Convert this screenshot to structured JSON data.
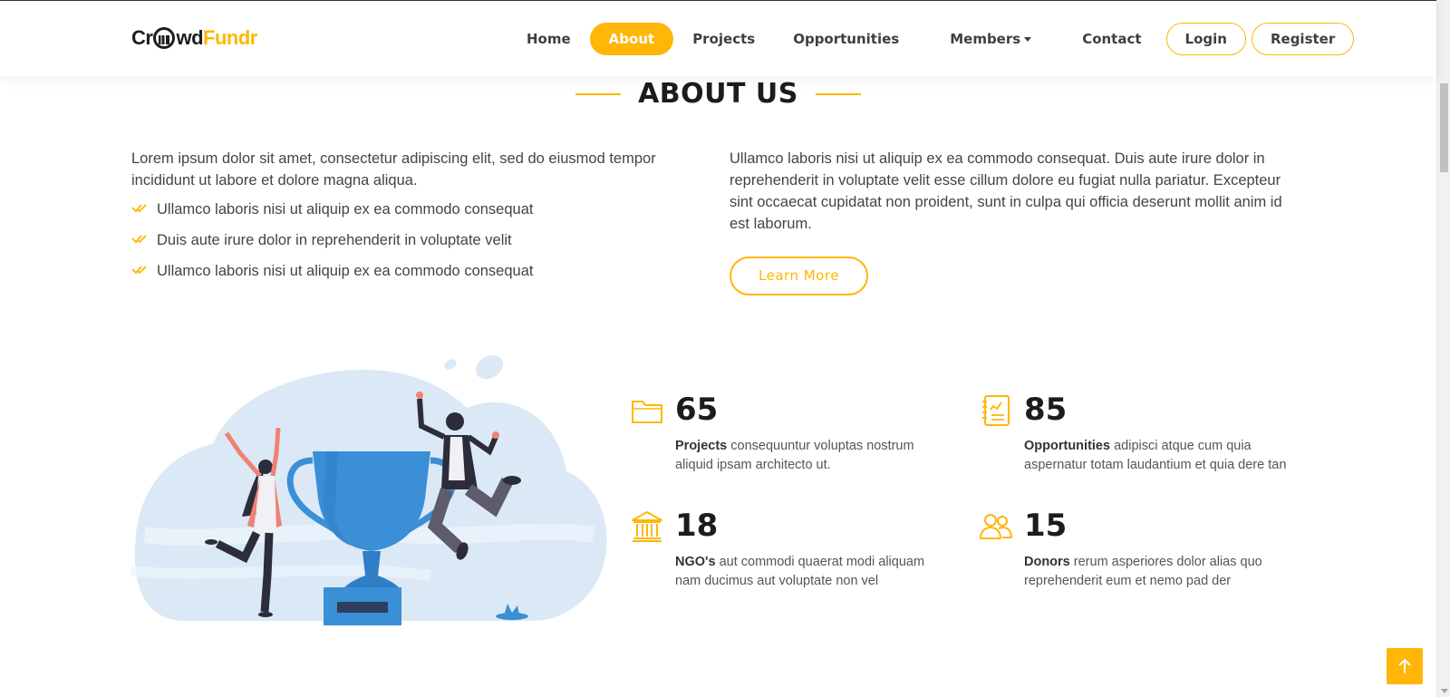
{
  "logo": {
    "part1": "Cr",
    "part2": "wd",
    "part3": "Fundr"
  },
  "nav": {
    "home": "Home",
    "about": "About",
    "projects": "Projects",
    "opportunities": "Opportunities",
    "members": "Members",
    "contact": "Contact",
    "login": "Login",
    "register": "Register"
  },
  "section": {
    "title": "ABOUT US"
  },
  "left": {
    "intro": "Lorem ipsum dolor sit amet, consectetur adipiscing elit, sed do eiusmod tempor incididunt ut labore et dolore magna aliqua.",
    "items": [
      "Ullamco laboris nisi ut aliquip ex ea commodo consequat",
      "Duis aute irure dolor in reprehenderit in voluptate velit",
      "Ullamco laboris nisi ut aliquip ex ea commodo consequat"
    ]
  },
  "right": {
    "text": "Ullamco laboris nisi ut aliquip ex ea commodo consequat. Duis aute irure dolor in reprehenderit in voluptate velit esse cillum dolore eu fugiat nulla pariatur. Excepteur sint occaecat cupidatat non proident, sunt in culpa qui officia deserunt mollit anim id est laborum.",
    "button": "Learn More"
  },
  "stats": [
    {
      "icon": "folder-icon",
      "number": "65",
      "label": "Projects",
      "text": " consequuntur voluptas nostrum aliquid ipsam architecto ut."
    },
    {
      "icon": "document-chart-icon",
      "number": "85",
      "label": "Opportunities",
      "text": " adipisci atque cum quia aspernatur totam laudantium et quia dere tan"
    },
    {
      "icon": "bank-icon",
      "number": "18",
      "label": "NGO's",
      "text": " aut commodi quaerat modi aliquam nam ducimus aut voluptate non vel"
    },
    {
      "icon": "people-icon",
      "number": "15",
      "label": "Donors",
      "text": " rerum asperiores dolor alias quo reprehenderit eum et nemo pad der"
    }
  ],
  "colors": {
    "accent": "#ffb606",
    "heading": "#1c1c1c",
    "illustration_bg": "#dbe9f6",
    "trophy": "#3a8fd6"
  }
}
